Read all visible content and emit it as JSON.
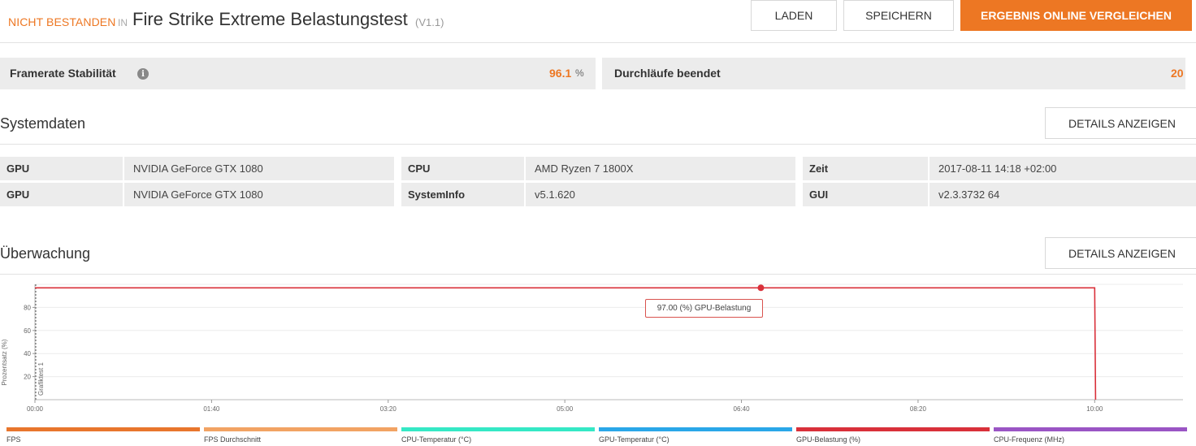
{
  "header": {
    "status": "NICHT BESTANDEN",
    "in_label": "IN",
    "title": "Fire Strike Extreme Belastungstest",
    "version": "(V1.1)",
    "buttons": {
      "load": "LADEN",
      "save": "SPEICHERN",
      "compare": "ERGEBNIS ONLINE VERGLEICHEN"
    }
  },
  "stats": {
    "stability_label": "Framerate Stabilität",
    "stability_value": "96.1",
    "stability_unit": "%",
    "loops_label": "Durchläufe beendet",
    "loops_value": "20"
  },
  "system": {
    "title": "Systemdaten",
    "details_button": "DETAILS ANZEIGEN",
    "rows": [
      [
        {
          "key": "GPU",
          "value": "NVIDIA GeForce GTX 1080"
        },
        {
          "key": "CPU",
          "value": "AMD Ryzen 7 1800X"
        },
        {
          "key": "Zeit",
          "value": "2017-08-11 14:18 +02:00"
        }
      ],
      [
        {
          "key": "GPU",
          "value": "NVIDIA GeForce GTX 1080"
        },
        {
          "key": "SystemInfo",
          "value": "v5.1.620"
        },
        {
          "key": "GUI",
          "value": "v2.3.3732 64"
        }
      ]
    ]
  },
  "monitoring": {
    "title": "Überwachung",
    "details_button": "DETAILS ANZEIGEN",
    "tooltip": "97.00 (%) GPU-Belastung"
  },
  "chart_data": {
    "type": "line",
    "ylabel": "Prozentsatz (%)",
    "marker_label": "Grafiktest 1",
    "ylim": [
      0,
      100
    ],
    "y_ticks": [
      "20",
      "40",
      "60",
      "80"
    ],
    "x_ticks": [
      "00:00",
      "01:40",
      "03:20",
      "05:00",
      "06:40",
      "08:20",
      "10:00"
    ],
    "xlim_seconds": [
      0,
      650
    ],
    "series": [
      {
        "name": "GPU-Belastung (%)",
        "color": "#d9303a",
        "points": [
          [
            0,
            97
          ],
          [
            600,
            97
          ],
          [
            600.5,
            0
          ]
        ]
      }
    ],
    "highlight": {
      "x_seconds": 411,
      "y": 97
    }
  },
  "legend": [
    {
      "label": "FPS",
      "color": "#e8762d"
    },
    {
      "label": "FPS Durchschnitt",
      "color": "#f2a363"
    },
    {
      "label": "CPU-Temperatur (°C)",
      "color": "#35e8c5"
    },
    {
      "label": "GPU-Temperatur (°C)",
      "color": "#2aa7e8"
    },
    {
      "label": "GPU-Belastung (%)",
      "color": "#d9303a"
    },
    {
      "label": "CPU-Frequenz (MHz)",
      "color": "#9a55c4"
    }
  ]
}
